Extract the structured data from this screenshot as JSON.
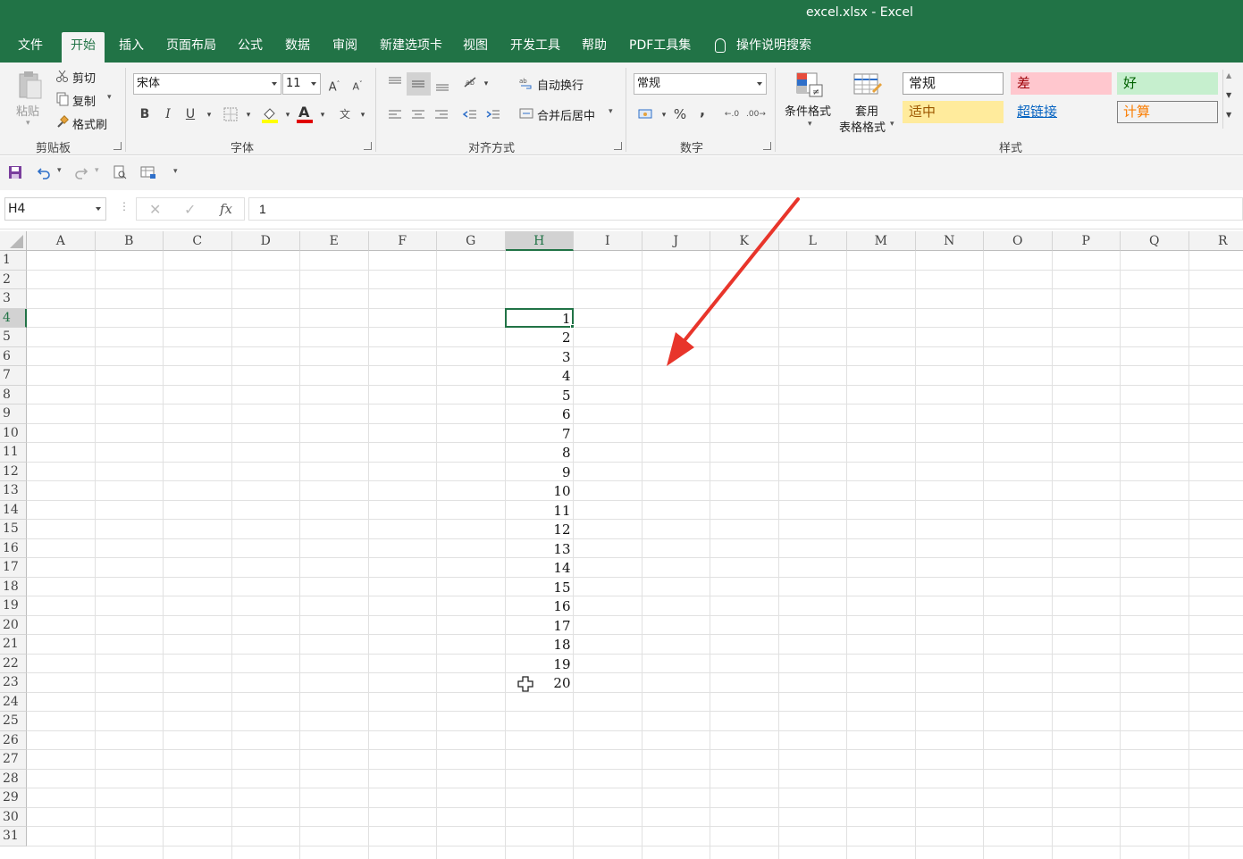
{
  "window": {
    "title": "excel.xlsx  -  Excel"
  },
  "tabs": [
    {
      "label": "文件"
    },
    {
      "label": "开始"
    },
    {
      "label": "插入"
    },
    {
      "label": "页面布局"
    },
    {
      "label": "公式"
    },
    {
      "label": "数据"
    },
    {
      "label": "审阅"
    },
    {
      "label": "新建选项卡"
    },
    {
      "label": "视图"
    },
    {
      "label": "开发工具"
    },
    {
      "label": "帮助"
    },
    {
      "label": "PDF工具集"
    }
  ],
  "active_tab": "开始",
  "tell_me": "操作说明搜索",
  "ribbon": {
    "clipboard": {
      "paste": "粘贴",
      "cut": "剪切",
      "copy": "复制",
      "format_painter": "格式刷",
      "group": "剪贴板"
    },
    "font": {
      "name": "宋体",
      "size": "11",
      "bold": "B",
      "italic": "I",
      "underline": "U",
      "group": "字体",
      "font_color_glyph": "A"
    },
    "alignment": {
      "wrap": "自动换行",
      "merge": "合并后居中",
      "group": "对齐方式"
    },
    "number": {
      "format": "常规",
      "percent": "%",
      "comma": ",",
      "group": "数字"
    },
    "styles": {
      "conditional": "条件格式",
      "table_line1": "套用",
      "table_line2": "表格格式",
      "group": "样式",
      "cells": [
        {
          "label": "常规",
          "bg": "#ffffff",
          "color": "#222222",
          "border": "#a0a0a0"
        },
        {
          "label": "差",
          "bg": "#ffc7ce",
          "color": "#9c0006",
          "border": "#ffc7ce"
        },
        {
          "label": "好",
          "bg": "#c6efce",
          "color": "#006100",
          "border": "#c6efce"
        },
        {
          "label": "适中",
          "bg": "#ffeb9c",
          "color": "#9c5700",
          "border": "#ffeb9c"
        },
        {
          "label": "超链接",
          "bg": "#f3f3f3",
          "color": "#0563c1",
          "border": "#f3f3f3"
        },
        {
          "label": "计算",
          "bg": "#f2f2f2",
          "color": "#fa7d00",
          "border": "#7f7f7f"
        }
      ]
    }
  },
  "formula_bar": {
    "name_box": "H4",
    "value": "1",
    "fx": "fx"
  },
  "columns": [
    "A",
    "B",
    "C",
    "D",
    "E",
    "F",
    "G",
    "H",
    "I",
    "J",
    "K",
    "L",
    "M",
    "N",
    "O",
    "P",
    "Q",
    "R"
  ],
  "selected_column": "H",
  "rows": [
    "1",
    "2",
    "3",
    "4",
    "5",
    "6",
    "7",
    "8",
    "9",
    "10",
    "11",
    "12",
    "13",
    "14",
    "15",
    "16",
    "17",
    "18",
    "19",
    "20",
    "21",
    "22",
    "23",
    "24",
    "25",
    "26",
    "27",
    "28",
    "29",
    "30",
    "31"
  ],
  "selected_row": "4",
  "column_h_values": [
    "1",
    "2",
    "3",
    "4",
    "5",
    "6",
    "7",
    "8",
    "9",
    "10",
    "11",
    "12",
    "13",
    "14",
    "15",
    "16",
    "17",
    "18",
    "19",
    "20"
  ],
  "values_start_row": "4",
  "colors": {
    "accent": "#217346",
    "arrow": "#e8352b"
  }
}
